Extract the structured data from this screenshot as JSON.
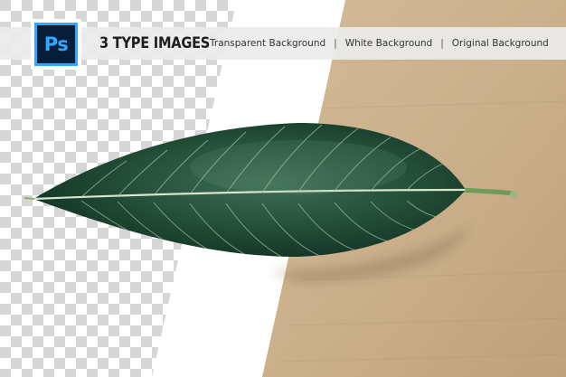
{
  "banner": {
    "logo_text": "Ps",
    "headline": "3 TYPE IMAGES",
    "types": [
      "Transparent Background",
      "White Background",
      "Original Background"
    ],
    "separator": "|"
  },
  "colors": {
    "banner_bg": "#ebebeb",
    "logo_bg": "#061e3a",
    "logo_accent": "#31a8ff",
    "cardboard": "#c9b08c",
    "leaf_green": "#1f4a32"
  },
  "image": {
    "subject": "leaf-icon",
    "panels": [
      "transparent-panel",
      "white-panel",
      "original-panel"
    ]
  }
}
